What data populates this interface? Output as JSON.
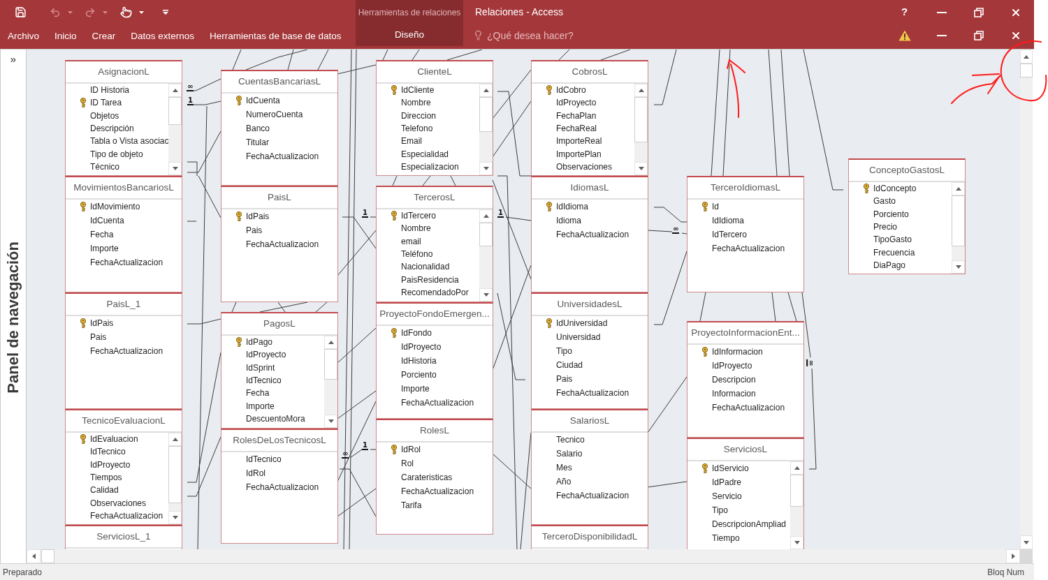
{
  "window": {
    "title": "Relaciones - Access",
    "help_label": "?"
  },
  "quick_access": [
    {
      "kind": "save",
      "disabled": false,
      "has_menu": false
    },
    {
      "kind": "undo",
      "disabled": true,
      "has_menu": true
    },
    {
      "kind": "redo",
      "disabled": true,
      "has_menu": true
    },
    {
      "kind": "touch_mode",
      "disabled": false,
      "has_menu": true
    },
    {
      "kind": "customize",
      "disabled": false,
      "has_menu": false
    }
  ],
  "ribbon": {
    "tabs": [
      {
        "label": "Archivo"
      },
      {
        "label": "Inicio"
      },
      {
        "label": "Crear"
      },
      {
        "label": "Datos externos"
      },
      {
        "label": "Herramientas de base de datos"
      }
    ],
    "contextual_group": {
      "label": "Herramientas de relaciones",
      "tabs": [
        {
          "label": "Diseño"
        }
      ]
    },
    "tell_me": {
      "placeholder": "¿Qué desea hacer?"
    }
  },
  "navigation_pane": {
    "title": "Panel de navegación"
  },
  "relationships": {
    "tables": [
      {
        "name": "AsignacionL",
        "fields": [
          {
            "name": "ID Historia",
            "primary_key": false
          },
          {
            "name": "ID Tarea",
            "primary_key": true
          },
          {
            "name": "Objetos",
            "primary_key": false
          },
          {
            "name": "Descripción",
            "primary_key": false
          },
          {
            "name": "Tabla o Vista asociac",
            "primary_key": false
          },
          {
            "name": "Tipo de objeto",
            "primary_key": false
          },
          {
            "name": "Técnico",
            "primary_key": false
          }
        ]
      },
      {
        "name": "MovimientosBancariosL",
        "fields": [
          {
            "name": "IdMovimiento",
            "primary_key": true
          },
          {
            "name": "IdCuenta",
            "primary_key": false
          },
          {
            "name": "Fecha",
            "primary_key": false
          },
          {
            "name": "Importe",
            "primary_key": false
          },
          {
            "name": "FechaActualizacion",
            "primary_key": false
          }
        ]
      },
      {
        "name": "PaisL_1",
        "fields": [
          {
            "name": "IdPais",
            "primary_key": true
          },
          {
            "name": "Pais",
            "primary_key": false
          },
          {
            "name": "FechaActualizacion",
            "primary_key": false
          }
        ]
      },
      {
        "name": "TecnicoEvaluacionL",
        "fields": [
          {
            "name": "IdEvaluacion",
            "primary_key": true
          },
          {
            "name": "IdTecnico",
            "primary_key": false
          },
          {
            "name": "IdProyecto",
            "primary_key": false
          },
          {
            "name": "Tiempos",
            "primary_key": false
          },
          {
            "name": "Calidad",
            "primary_key": false
          },
          {
            "name": "Observaciones",
            "primary_key": false
          },
          {
            "name": "FechaActualizacion",
            "primary_key": false
          }
        ]
      },
      {
        "name": "ServiciosL_1"
      },
      {
        "name": "CuentasBancariasL",
        "fields": [
          {
            "name": "IdCuenta",
            "primary_key": true
          },
          {
            "name": "NumeroCuenta",
            "primary_key": false
          },
          {
            "name": "Banco",
            "primary_key": false
          },
          {
            "name": "Titular",
            "primary_key": false
          },
          {
            "name": "FechaActualizacion",
            "primary_key": false
          }
        ]
      },
      {
        "name": "PaisL",
        "fields": [
          {
            "name": "IdPais",
            "primary_key": true
          },
          {
            "name": "Pais",
            "primary_key": false
          },
          {
            "name": "FechaActualizacion",
            "primary_key": false
          }
        ]
      },
      {
        "name": "PagosL",
        "fields": [
          {
            "name": "IdPago",
            "primary_key": true
          },
          {
            "name": "IdProyecto",
            "primary_key": false
          },
          {
            "name": "IdSprint",
            "primary_key": false
          },
          {
            "name": "IdTecnico",
            "primary_key": false
          },
          {
            "name": "Fecha",
            "primary_key": false
          },
          {
            "name": "Importe",
            "primary_key": false
          },
          {
            "name": "DescuentoMora",
            "primary_key": false
          }
        ]
      },
      {
        "name": "RolesDeLosTecnicosL",
        "fields": [
          {
            "name": "IdTecnico",
            "primary_key": false
          },
          {
            "name": "IdRol",
            "primary_key": false
          },
          {
            "name": "FechaActualizacion",
            "primary_key": false
          }
        ]
      },
      {
        "name": "ClienteL",
        "fields": [
          {
            "name": "IdCliente",
            "primary_key": true
          },
          {
            "name": "Nombre",
            "primary_key": false
          },
          {
            "name": "Direccion",
            "primary_key": false
          },
          {
            "name": "Telefono",
            "primary_key": false
          },
          {
            "name": "Email",
            "primary_key": false
          },
          {
            "name": "Especialidad",
            "primary_key": false
          },
          {
            "name": "Especializacion",
            "primary_key": false
          }
        ]
      },
      {
        "name": "TercerosL",
        "fields": [
          {
            "name": "IdTercero",
            "primary_key": true
          },
          {
            "name": "Nombre",
            "primary_key": false
          },
          {
            "name": "email",
            "primary_key": false
          },
          {
            "name": "Teléfono",
            "primary_key": false
          },
          {
            "name": "Nacionalidad",
            "primary_key": false
          },
          {
            "name": "PaisResidencia",
            "primary_key": false
          },
          {
            "name": "RecomendadoPor",
            "primary_key": false
          }
        ]
      },
      {
        "name": "ProyectoFondoEmergen...",
        "fields": [
          {
            "name": "IdFondo",
            "primary_key": true
          },
          {
            "name": "IdProyecto",
            "primary_key": false
          },
          {
            "name": "IdHistoria",
            "primary_key": false
          },
          {
            "name": "Porciento",
            "primary_key": false
          },
          {
            "name": "Importe",
            "primary_key": false
          },
          {
            "name": "FechaActualizacion",
            "primary_key": false
          }
        ]
      },
      {
        "name": "RolesL",
        "fields": [
          {
            "name": "IdRol",
            "primary_key": true
          },
          {
            "name": "Rol",
            "primary_key": false
          },
          {
            "name": "Carateristicas",
            "primary_key": false
          },
          {
            "name": "FechaActualizacion",
            "primary_key": false
          },
          {
            "name": "Tarifa",
            "primary_key": false
          }
        ]
      },
      {
        "name": "CobrosL",
        "fields": [
          {
            "name": "IdCobro",
            "primary_key": true
          },
          {
            "name": "IdProyecto",
            "primary_key": false
          },
          {
            "name": "FechaPlan",
            "primary_key": false
          },
          {
            "name": "FechaReal",
            "primary_key": false
          },
          {
            "name": "ImporteReal",
            "primary_key": false
          },
          {
            "name": "ImportePlan",
            "primary_key": false
          },
          {
            "name": "Observaciones",
            "primary_key": false
          }
        ]
      },
      {
        "name": "IdiomasL",
        "fields": [
          {
            "name": "IdIdioma",
            "primary_key": true
          },
          {
            "name": "Idioma",
            "primary_key": false
          },
          {
            "name": "FechaActualizacion",
            "primary_key": false
          }
        ]
      },
      {
        "name": "UniversidadesL",
        "fields": [
          {
            "name": "IdUniversidad",
            "primary_key": true
          },
          {
            "name": "Universidad",
            "primary_key": false
          },
          {
            "name": "Tipo",
            "primary_key": false
          },
          {
            "name": "Ciudad",
            "primary_key": false
          },
          {
            "name": "Pais",
            "primary_key": false
          },
          {
            "name": "FechaActualizacion",
            "primary_key": false
          }
        ]
      },
      {
        "name": "SalariosL",
        "fields": [
          {
            "name": "Tecnico",
            "primary_key": false
          },
          {
            "name": "Salario",
            "primary_key": false
          },
          {
            "name": "Mes",
            "primary_key": false
          },
          {
            "name": "Año",
            "primary_key": false
          },
          {
            "name": "FechaActualizacion",
            "primary_key": false
          }
        ]
      },
      {
        "name": "TerceroDisponibilidadL"
      },
      {
        "name": "TerceroIdiomasL",
        "fields": [
          {
            "name": "Id",
            "primary_key": true
          },
          {
            "name": "IdIdioma",
            "primary_key": false
          },
          {
            "name": "IdTercero",
            "primary_key": false
          },
          {
            "name": "FechaActualizacion",
            "primary_key": false
          }
        ]
      },
      {
        "name": "ProyectoInformacionEnt...",
        "fields": [
          {
            "name": "IdInformacion",
            "primary_key": true
          },
          {
            "name": "IdProyecto",
            "primary_key": false
          },
          {
            "name": "Descripcion",
            "primary_key": false
          },
          {
            "name": "Informacion",
            "primary_key": false
          },
          {
            "name": "FechaActualizacion",
            "primary_key": false
          }
        ]
      },
      {
        "name": "ServiciosL",
        "fields": [
          {
            "name": "IdServicio",
            "primary_key": true
          },
          {
            "name": "IdPadre",
            "primary_key": false
          },
          {
            "name": "Servicio",
            "primary_key": false
          },
          {
            "name": "Tipo",
            "primary_key": false
          },
          {
            "name": "DescripcionAmpliad",
            "primary_key": false
          },
          {
            "name": "Tiempo",
            "primary_key": false
          }
        ]
      },
      {
        "name": "ConceptoGastosL",
        "fields": [
          {
            "name": "IdConcepto",
            "primary_key": true
          },
          {
            "name": "Gasto",
            "primary_key": false
          },
          {
            "name": "Porciento",
            "primary_key": false
          },
          {
            "name": "Precio",
            "primary_key": false
          },
          {
            "name": "TipoGasto",
            "primary_key": false
          },
          {
            "name": "Frecuencia",
            "primary_key": false
          },
          {
            "name": "DiaPago",
            "primary_key": false
          }
        ]
      }
    ],
    "cardinality_marks": [
      {
        "text": "∞"
      },
      {
        "text": "1"
      },
      {
        "text": "1"
      },
      {
        "text": "1"
      },
      {
        "text": "∞"
      },
      {
        "text": "∞"
      },
      {
        "text": "1"
      },
      {
        "text": "∞"
      }
    ]
  },
  "status_bar": {
    "left": "Preparado",
    "right": "Bloq Num"
  }
}
